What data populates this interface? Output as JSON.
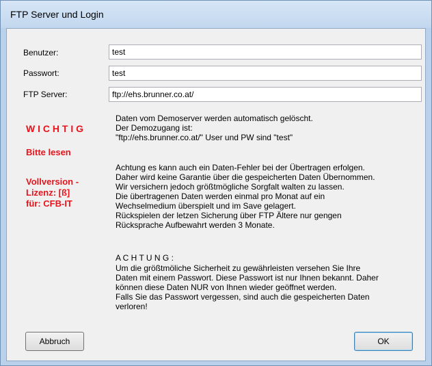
{
  "window": {
    "title": "FTP Server und Login"
  },
  "form": {
    "user_label": "Benutzer:",
    "user_value": "test",
    "password_label": "Passwort:",
    "password_value": "test",
    "server_label": "FTP Server:",
    "server_value": "ftp://ehs.brunner.co.at/"
  },
  "sidebar": {
    "wichtig": "W I C H T I G",
    "bitte": "Bitte lesen",
    "vollversion_1": "Vollversion -",
    "vollversion_2": "Lizenz: [ß]",
    "vollversion_3": "für: CFB-IT"
  },
  "info": {
    "p1": "Daten vom Demoserver werden automatisch gelöscht.\nDer Demozugang ist:\n\"ftp://ehs.brunner.co.at/\" User und PW sind \"test\"",
    "p2": "Achtung es kann auch ein Daten-Fehler bei der Übertragen erfolgen.\nDaher wird keine Garantie über die gespeicherten Daten Übernommen.\nWir versichern jedoch größtmögliche Sorgfalt walten zu lassen.\nDie übertragenen Daten werden einmal pro Monat auf ein\nWechselmedium überspielt und im Save gelagert.\nRückspielen der letzen Sicherung über FTP Ältere nur gengen\nRücksprache Aufbewahrt werden 3 Monate.",
    "p3_heading": "A C H T U N G :",
    "p3": "Um die größtmöliche Sicherheit zu gewährleisten versehen Sie Ihre\nDaten mit einem Passwort. Diese Passwort ist nur Ihnen bekannt. Daher\nkönnen diese Daten NUR von Ihnen wieder geöffnet werden.\nFalls Sie das Passwort vergessen, sind auch die gespeicherten Daten\nverloren!"
  },
  "buttons": {
    "cancel": "Abbruch",
    "ok": "OK"
  }
}
